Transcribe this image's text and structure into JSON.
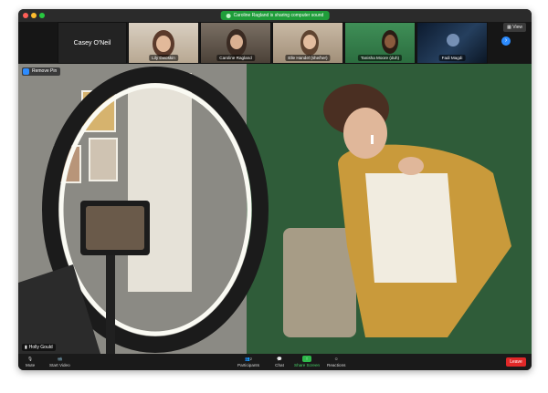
{
  "banner": {
    "text": "Caroline Ragland is sharing computer sound"
  },
  "view_label": "View",
  "participants": [
    {
      "name": "Casey O'Neil"
    },
    {
      "name": "Lily Dwoskin"
    },
    {
      "name": "Caroline Ragland"
    },
    {
      "name": "Elle Handel (she/her)"
    },
    {
      "name": "Tanisha Moore (duh)"
    },
    {
      "name": "Fadi Magdi"
    }
  ],
  "stage": {
    "remove_pin_label": "Remove Pin",
    "speaker_name": "Holly Gould"
  },
  "toolbar": {
    "mute": "Mute",
    "start_video": "Start Video",
    "participants": "Participants",
    "participants_count": "2",
    "chat": "Chat",
    "share_screen": "Share Screen",
    "reactions": "Reactions",
    "leave": "Leave"
  },
  "colors": {
    "accent": "#2d8cff",
    "share_green": "#1f9d3a",
    "leave_red": "#e02828"
  }
}
